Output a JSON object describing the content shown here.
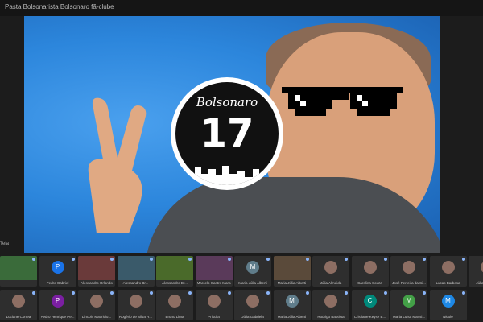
{
  "window": {
    "title": "Pasta Bolsonarista Bolsonaro fã-clube"
  },
  "presentation": {
    "brand_text": "Bolsonaro",
    "number": "17",
    "speaker_label": "Tela"
  },
  "participants_row1": [
    {
      "name": "",
      "avatar": "",
      "kind": "video"
    },
    {
      "name": "Pedro Gabriel",
      "avatar": "P",
      "color": "#1a73e8",
      "kind": "avatar"
    },
    {
      "name": "Alessandro Orlando",
      "avatar": "",
      "kind": "video"
    },
    {
      "name": "Alessandro Br...",
      "avatar": "",
      "kind": "video"
    },
    {
      "name": "Alessandro Br...",
      "avatar": "",
      "kind": "video"
    },
    {
      "name": "Marcelo Castro Marce...",
      "avatar": "",
      "kind": "video"
    },
    {
      "name": "Maria Júlia Alberti",
      "avatar": "M",
      "color": "#607d8b",
      "kind": "avatar"
    },
    {
      "name": "Maria Júlia Alberti",
      "avatar": "",
      "kind": "video"
    },
    {
      "name": "Júlia Almeida",
      "avatar": "",
      "kind": "photo"
    },
    {
      "name": "Carolina Souza",
      "avatar": "",
      "kind": "photo"
    },
    {
      "name": "José Ferreira da Si...",
      "avatar": "",
      "kind": "photo"
    },
    {
      "name": "Lucas Barbosa",
      "avatar": "",
      "kind": "photo"
    },
    {
      "name": "Júlia Gabriele",
      "avatar": "",
      "kind": "photo"
    }
  ],
  "participants_row2": [
    {
      "name": "Luciane Correa",
      "avatar": "",
      "kind": "photo"
    },
    {
      "name": "Pedro Henrique Pe...",
      "avatar": "P",
      "color": "#7b1fa2",
      "kind": "avatar"
    },
    {
      "name": "Lincoln Mauricio...",
      "avatar": "",
      "kind": "photo"
    },
    {
      "name": "Rogério de Silva R...",
      "avatar": "",
      "kind": "photo"
    },
    {
      "name": "Bruno Lima",
      "avatar": "",
      "kind": "photo"
    },
    {
      "name": "Priscila",
      "avatar": "",
      "kind": "photo"
    },
    {
      "name": "Júlia Gabriela",
      "avatar": "",
      "kind": "photo"
    },
    {
      "name": "Maria Júlia Alberti",
      "avatar": "M",
      "color": "#607d8b",
      "kind": "avatar"
    },
    {
      "name": "Rodrigo Baptista",
      "avatar": "",
      "kind": "photo"
    },
    {
      "name": "Cristiane Keyse E...",
      "avatar": "C",
      "color": "#00897b",
      "kind": "avatar"
    },
    {
      "name": "Maria Luisa Mansi...",
      "avatar": "M",
      "color": "#43a047",
      "kind": "avatar"
    },
    {
      "name": "Nicole",
      "avatar": "M",
      "color": "#1e88e5",
      "kind": "avatar"
    }
  ],
  "colors": {
    "stage_bg": "#2c86dc",
    "tile_bg": "#2e2e2e",
    "page_bg": "#1c1c1c"
  }
}
